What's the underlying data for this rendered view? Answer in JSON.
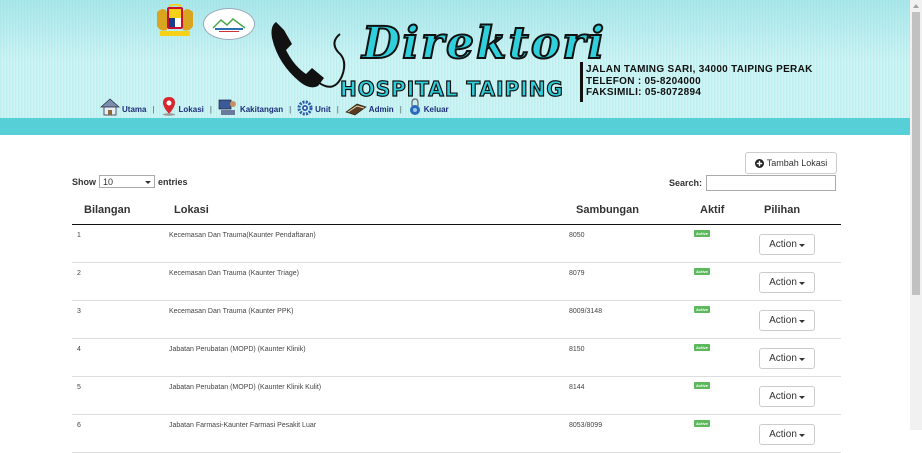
{
  "header": {
    "brand_title": "Direktori",
    "brand_subtitle": "HOSPITAL TAIPING",
    "address": "JALAN TAMING SARI, 34000 TAIPING PERAK",
    "phone": "TELEFON : 05-8204000",
    "fax": "FAKSIMILI: 05-8072894",
    "nav": [
      {
        "label": "Utama",
        "icon": "home-icon"
      },
      {
        "label": "Lokasi",
        "icon": "location-pin-icon"
      },
      {
        "label": "Kakitangan",
        "icon": "staff-icon"
      },
      {
        "label": "Unit",
        "icon": "gear-icon"
      },
      {
        "label": "Admin",
        "icon": "admin-book-icon"
      },
      {
        "label": "Keluar",
        "icon": "logout-lock-icon"
      }
    ],
    "separator": "|"
  },
  "toolbar": {
    "add_location_label": "Tambah Lokasi",
    "show_label": "Show",
    "entries_value": "10",
    "entries_label": "entries",
    "search_label": "Search:",
    "search_value": ""
  },
  "table": {
    "headers": [
      "Bilangan",
      "Lokasi",
      "Sambungan",
      "Aktif",
      "Pilihan"
    ],
    "rows": [
      {
        "no": "1",
        "lokasi": "Kecemasan Dan Trauma(Kaunter Pendaftaran)",
        "sambungan": "8050",
        "aktif": "Active",
        "action": "Action"
      },
      {
        "no": "2",
        "lokasi": "Kecemasan Dan Trauma (Kaunter Triage)",
        "sambungan": "8079",
        "aktif": "Active",
        "action": "Action"
      },
      {
        "no": "3",
        "lokasi": "Kecemasan Dan Trauma (Kaunter PPK)",
        "sambungan": "8009/3148",
        "aktif": "Active",
        "action": "Action"
      },
      {
        "no": "4",
        "lokasi": "Jabatan Perubatan (MOPD) (Kaunter Klinik)",
        "sambungan": "8150",
        "aktif": "Active",
        "action": "Action"
      },
      {
        "no": "5",
        "lokasi": "Jabatan Perubatan (MOPD) (Kaunter Klinik Kulit)",
        "sambungan": "8144",
        "aktif": "Active",
        "action": "Action"
      },
      {
        "no": "6",
        "lokasi": "Jabatan Farmasi-Kaunter Farmasi Pesakit Luar",
        "sambungan": "8053/8099",
        "aktif": "Active",
        "action": "Action"
      }
    ]
  },
  "colors": {
    "header_band": "#56cfd6",
    "brand_cyan": "#2fd0dc",
    "active_badge": "#5cb85c"
  }
}
